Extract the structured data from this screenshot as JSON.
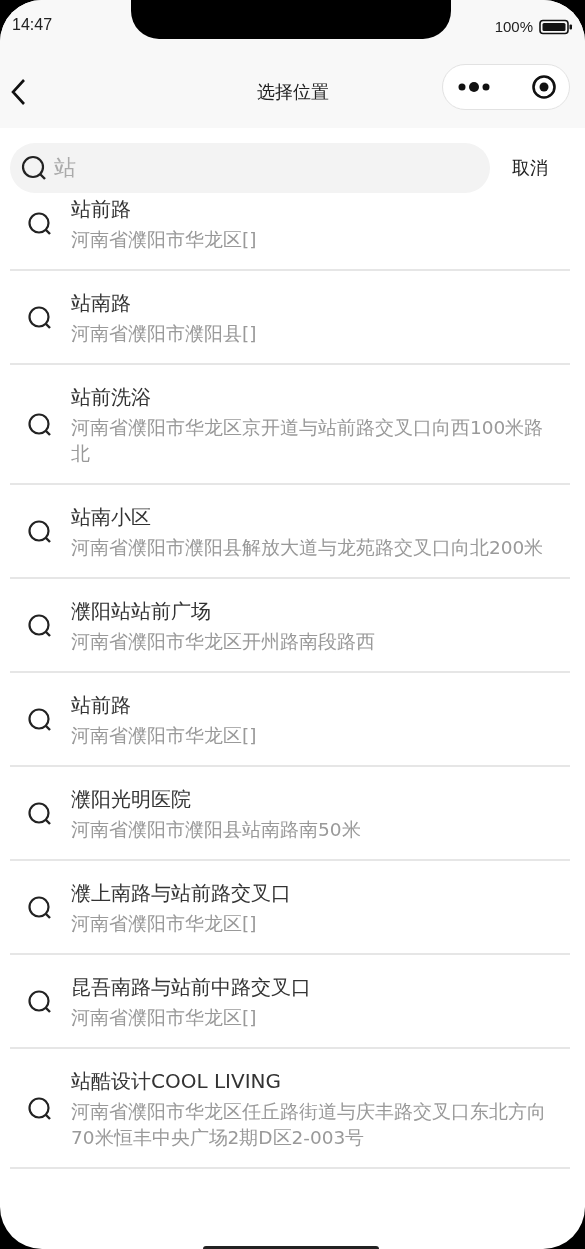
{
  "status_bar": {
    "time": "14:47",
    "battery": "100%"
  },
  "nav_bar": {
    "title": "选择位置"
  },
  "search": {
    "value": "站",
    "cancel": "取消"
  },
  "results": [
    {
      "name": "站前路",
      "address": "河南省濮阳市华龙区[]"
    },
    {
      "name": "站南路",
      "address": "河南省濮阳市濮阳县[]"
    },
    {
      "name": "站前洗浴",
      "address": "河南省濮阳市华龙区京开道与站前路交叉口向西100米路北"
    },
    {
      "name": "站南小区",
      "address": "河南省濮阳市濮阳县解放大道与龙苑路交叉口向北200米"
    },
    {
      "name": "濮阳站站前广场",
      "address": "河南省濮阳市华龙区开州路南段路西"
    },
    {
      "name": "站前路",
      "address": "河南省濮阳市华龙区[]"
    },
    {
      "name": "濮阳光明医院",
      "address": "河南省濮阳市濮阳县站南路南50米"
    },
    {
      "name": "濮上南路与站前路交叉口",
      "address": "河南省濮阳市华龙区[]"
    },
    {
      "name": "昆吾南路与站前中路交叉口",
      "address": "河南省濮阳市华龙区[]"
    },
    {
      "name": "站酷设计COOL LIVING",
      "address": "河南省濮阳市华龙区任丘路街道与庆丰路交叉口东北方向70米恒丰中央广场2期D区2-003号"
    }
  ]
}
